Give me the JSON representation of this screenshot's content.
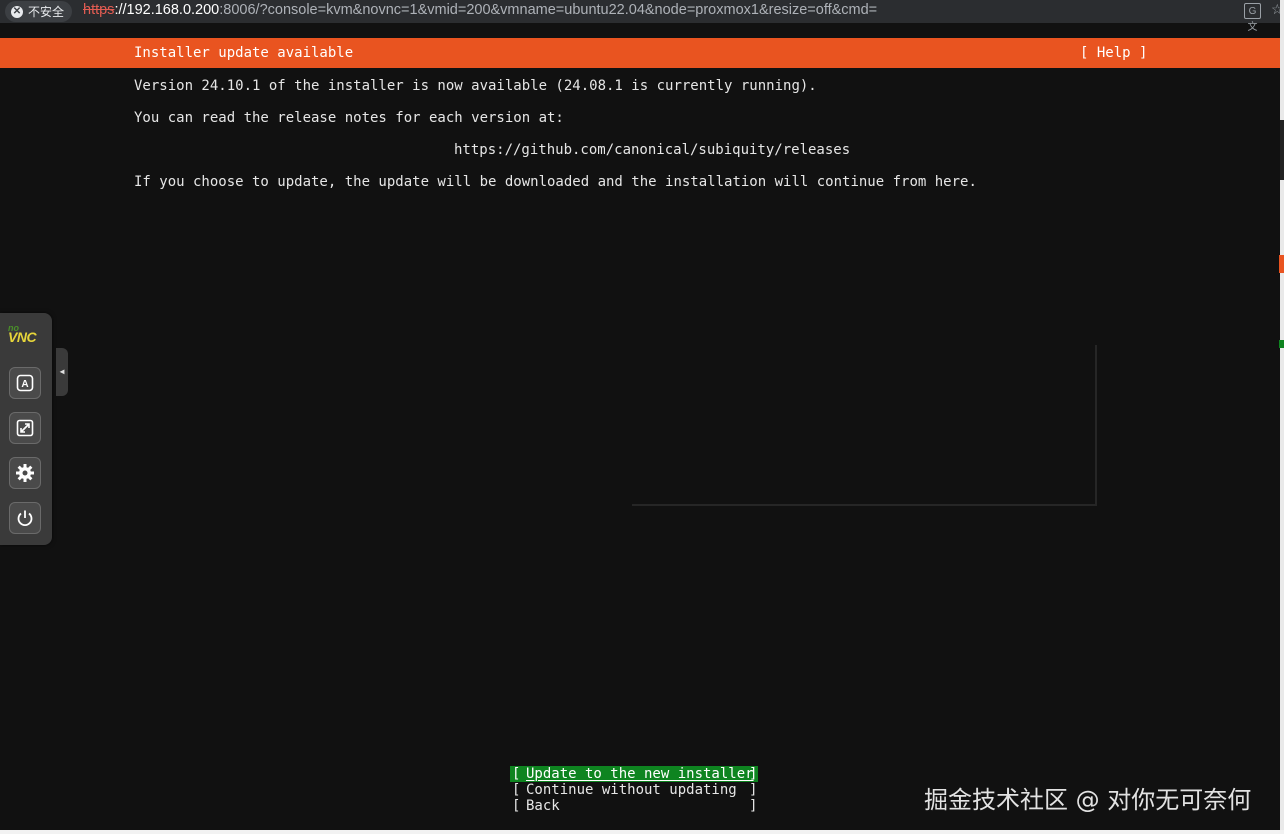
{
  "browser": {
    "security_label": "不安全",
    "url_scheme": "https",
    "url_host": "://192.168.0.200",
    "url_rest": ":8006/?console=kvm&novnc=1&vmid=200&vmname=ubuntu22.04&node=proxmox1&resize=off&cmd="
  },
  "installer": {
    "header_title": "Installer update available",
    "help_label": "[ Help ]",
    "lines": [
      "Version 24.10.1 of the installer is now available (24.08.1 is currently running).",
      "You can read the release notes for each version at:",
      "https://github.com/canonical/subiquity/releases",
      "If you choose to update, the update will be downloaded and the installation will continue from here."
    ],
    "menu": [
      {
        "label": "Update to the new installer",
        "selected": true
      },
      {
        "label": "Continue without updating",
        "selected": false
      },
      {
        "label": "Back",
        "selected": false
      }
    ],
    "bracket_left": "[",
    "bracket_right": "]"
  },
  "novnc": {
    "logo_no": "no",
    "logo_vnc": "VNC",
    "buttons": [
      "extra-keys-icon",
      "fullscreen-icon",
      "settings-icon",
      "power-icon"
    ]
  },
  "watermark": "掘金技术社区 @ 对你无可奈何",
  "colors": {
    "header_orange": "#e95420",
    "selection_green": "#0e8420",
    "screen_bg": "#111111"
  }
}
